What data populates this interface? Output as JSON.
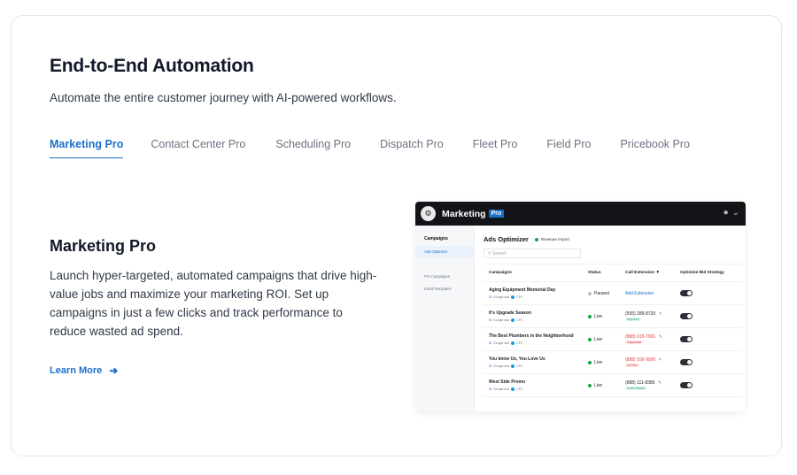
{
  "header": {
    "title": "End-to-End Automation",
    "subtitle": "Automate the entire customer journey with AI-powered workflows."
  },
  "tabs": [
    {
      "label": "Marketing Pro",
      "active": true
    },
    {
      "label": "Contact Center Pro",
      "active": false
    },
    {
      "label": "Scheduling Pro",
      "active": false
    },
    {
      "label": "Dispatch Pro",
      "active": false
    },
    {
      "label": "Fleet Pro",
      "active": false
    },
    {
      "label": "Field Pro",
      "active": false
    },
    {
      "label": "Pricebook Pro",
      "active": false
    }
  ],
  "feature": {
    "title": "Marketing Pro",
    "description": "Launch hyper-targeted, automated campaigns that drive high-value jobs and maximize your marketing ROI. Set up campaigns in just a few clicks and track performance to reduce wasted ad spend.",
    "learn_more": "Learn More"
  },
  "mockup": {
    "brand": "Marketing",
    "badge": "Pro",
    "sidebar": {
      "heading": "Campaigns",
      "items": [
        "Ads Optimizer",
        "Pro Campaigns",
        "Email Templates"
      ]
    },
    "page_title": "Ads Optimizer",
    "revenue_import": "Revenue Import",
    "search_placeholder": "Search",
    "columns": [
      "Campaigns",
      "Status",
      "Call Extension",
      "Optimize Bid Strategy"
    ],
    "rows": [
      {
        "name": "Aging Equipment Memorial Day",
        "source": "Google Ads",
        "type": "CPC",
        "status": "Paused",
        "status_color": "#b8bec6",
        "call": "Add Extension",
        "call_color": "#1a6fc9",
        "tag": ""
      },
      {
        "name": "It's Upgrade Season",
        "source": "Google Ads",
        "type": "CPC",
        "status": "Live",
        "status_color": "#16a34a",
        "call": "(555) 289-8720",
        "call_color": "#222222",
        "tag": "Approved"
      },
      {
        "name": "The Best Plumbers in the Neighborhood",
        "source": "Google Ads",
        "type": "CPC",
        "status": "Live",
        "status_color": "#16a34a",
        "call": "(888) 015-7001",
        "call_color": "#e23a3a",
        "tag": "Suspended"
      },
      {
        "name": "You know Us, You Love Us",
        "source": "Google Ads",
        "type": "CPC",
        "status": "Live",
        "status_color": "#16a34a",
        "call": "(888) 100-9000",
        "call_color": "#e23a3a",
        "tag": "Ad Error"
      },
      {
        "name": "West Side Promo",
        "source": "Google Ads",
        "type": "CPC",
        "status": "Live",
        "status_color": "#16a34a",
        "call": "(888) 111-8385",
        "call_color": "#222222",
        "tag": "Under Review"
      }
    ]
  },
  "colors": {
    "accent": "#1a6fc9",
    "live": "#16a34a",
    "error": "#e23a3a",
    "topbar": "#121417"
  }
}
